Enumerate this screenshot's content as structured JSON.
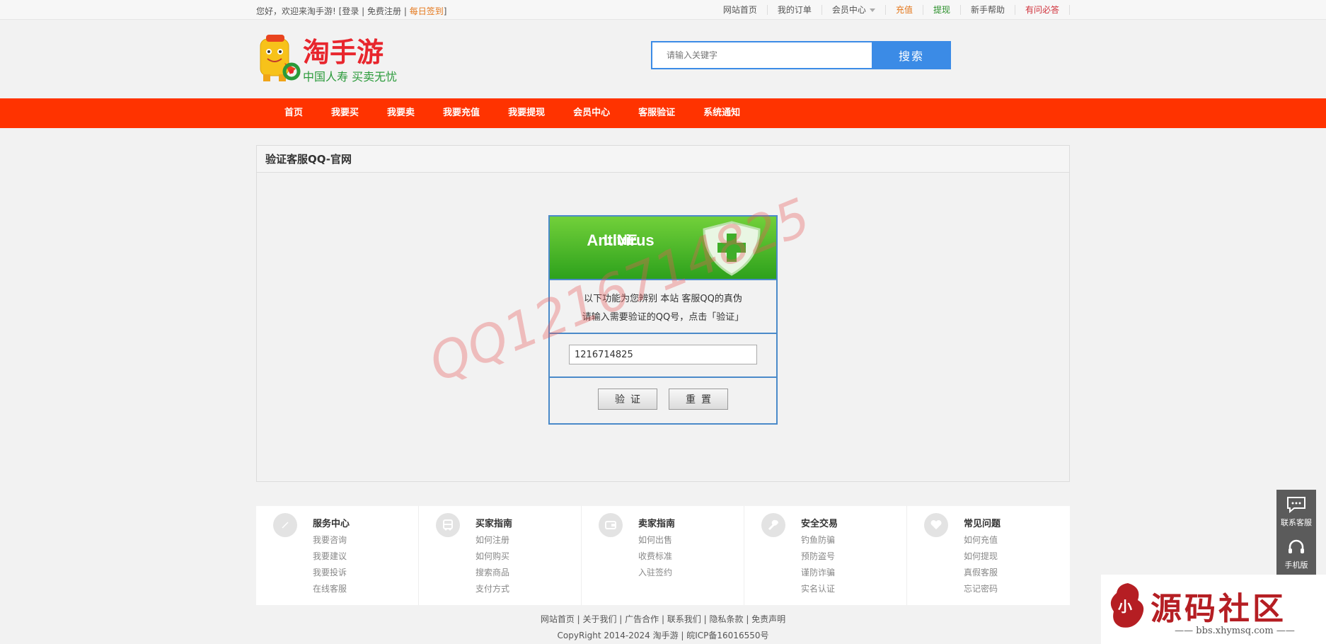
{
  "topbar": {
    "welcome": "您好，欢迎来淘手游!",
    "login": "登录",
    "register": "免费注册",
    "checkin": "每日签到",
    "links": [
      {
        "label": "网站首页",
        "color": "#555555"
      },
      {
        "label": "我的订单",
        "color": "#555555"
      },
      {
        "label": "会员中心",
        "color": "#555555",
        "dropdown": true
      },
      {
        "label": "充值",
        "color": "#e4771b"
      },
      {
        "label": "提现",
        "color": "#2a8f2a"
      },
      {
        "label": "新手帮助",
        "color": "#555555"
      },
      {
        "label": "有问必答",
        "color": "#d0303a"
      }
    ]
  },
  "logo": {
    "brand": "淘手游",
    "slogan": "中国人寿 买卖无忧",
    "brand_color": "#e8262d",
    "slogan_color": "#2a9a3a"
  },
  "search": {
    "placeholder": "请输入关键字",
    "button": "搜索"
  },
  "nav": {
    "items": [
      "首页",
      "我要买",
      "我要卖",
      "我要充值",
      "我要提现",
      "会员中心",
      "客服验证",
      "系统通知"
    ],
    "color": "#ff3300"
  },
  "panel": {
    "title": "验证客服QQ-官网"
  },
  "verify": {
    "banner_line1": "LINE",
    "banner_line2": "Antivirus",
    "desc_line1": "以下功能为您辨别 本站 客服QQ的真伪",
    "desc_line2": "请输入需要验证的QQ号，点击「验证」",
    "qq_value": "1216714825",
    "verify_button": "验证",
    "reset_button": "重置"
  },
  "watermark": {
    "text": "QQ1216714825"
  },
  "guide": [
    {
      "icon": "compass-icon",
      "title": "服务中心",
      "links": [
        "我要咨询",
        "我要建议",
        "我要投诉",
        "在线客服"
      ]
    },
    {
      "icon": "bus-icon",
      "title": "买家指南",
      "links": [
        "如何注册",
        "如何购买",
        "搜索商品",
        "支付方式"
      ]
    },
    {
      "icon": "wallet-icon",
      "title": "卖家指南",
      "links": [
        "如何出售",
        "收费标准",
        "入驻签约"
      ]
    },
    {
      "icon": "wrench-icon",
      "title": "安全交易",
      "links": [
        "钓鱼防骗",
        "预防盗号",
        "谨防诈骗",
        "实名认证"
      ]
    },
    {
      "icon": "heart-icon",
      "title": "常见问题",
      "links": [
        "如何充值",
        "如何提现",
        "真假客服",
        "忘记密码"
      ]
    }
  ],
  "footer": {
    "links": "网站首页 | 关于我们 | 广告合作 | 联系我们 | 隐私条款 | 免责声明",
    "copyright": "CopyRight 2014-2024 淘手游 | 皖ICP备16016550号"
  },
  "side": {
    "contact": "联系客服",
    "mobile": "手机版"
  },
  "sitemark": {
    "title": "源码社区",
    "url": "—— bbs.xhymsq.com ——"
  }
}
